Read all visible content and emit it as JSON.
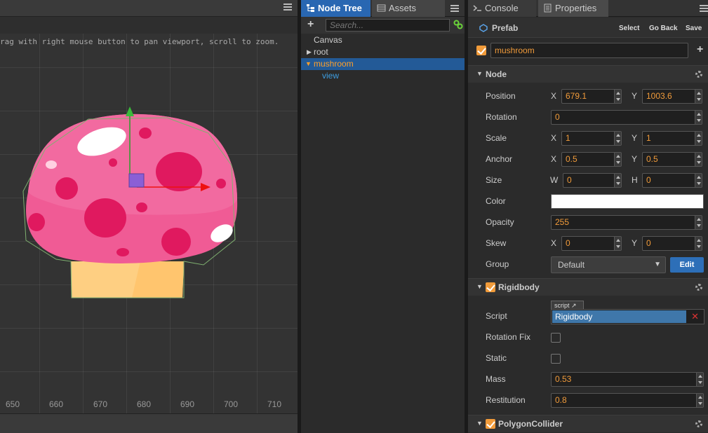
{
  "scene": {
    "hint": "rag with right mouse button to pan viewport, scroll to zoom.",
    "ruler": [
      "650",
      "660",
      "670",
      "680",
      "690",
      "700",
      "710"
    ]
  },
  "tree": {
    "tabs": [
      {
        "label": "Node Tree",
        "active": true
      },
      {
        "label": "Assets",
        "active": false
      }
    ],
    "search_placeholder": "Search...",
    "items": [
      {
        "label": "Canvas"
      },
      {
        "label": "root"
      },
      {
        "label": "mushroom"
      },
      {
        "label": "view"
      }
    ]
  },
  "props": {
    "tabs": [
      {
        "label": "Console"
      },
      {
        "label": "Properties"
      }
    ],
    "header": {
      "title": "Prefab",
      "select": "Select",
      "go_back": "Go Back",
      "save": "Save"
    },
    "name": "mushroom",
    "node_section": "Node",
    "position": {
      "label": "Position",
      "x_label": "X",
      "x": "679.1",
      "y_label": "Y",
      "y": "1003.6"
    },
    "rotation": {
      "label": "Rotation",
      "value": "0"
    },
    "scale": {
      "label": "Scale",
      "x_label": "X",
      "x": "1",
      "y_label": "Y",
      "y": "1"
    },
    "anchor": {
      "label": "Anchor",
      "x_label": "X",
      "x": "0.5",
      "y_label": "Y",
      "y": "0.5"
    },
    "size": {
      "label": "Size",
      "w_label": "W",
      "w": "0",
      "h_label": "H",
      "h": "0"
    },
    "color": {
      "label": "Color",
      "value": "#ffffff"
    },
    "opacity": {
      "label": "Opacity",
      "value": "255"
    },
    "skew": {
      "label": "Skew",
      "x_label": "X",
      "x": "0",
      "y_label": "Y",
      "y": "0"
    },
    "group": {
      "label": "Group",
      "value": "Default",
      "edit": "Edit"
    },
    "rigidbody_section": "Rigidbody",
    "script": {
      "label": "Script",
      "badge": "script",
      "value": "Rigidbody"
    },
    "rotation_fix": {
      "label": "Rotation Fix"
    },
    "static": {
      "label": "Static"
    },
    "mass": {
      "label": "Mass",
      "value": "0.53"
    },
    "restitution": {
      "label": "Restitution",
      "value": "0.8"
    },
    "polygon_section": "PolygonCollider"
  }
}
